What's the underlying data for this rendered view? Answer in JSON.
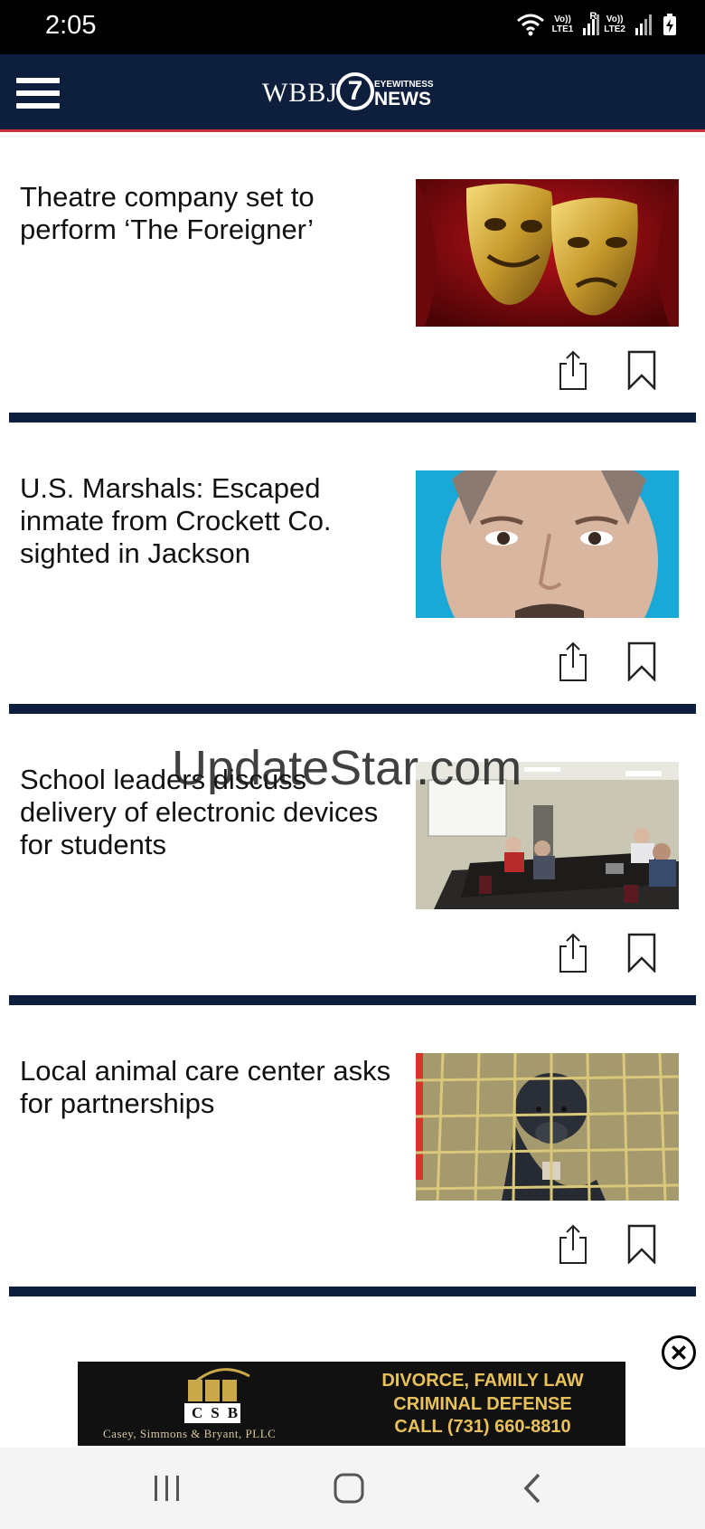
{
  "status_bar": {
    "time": "2:05",
    "sim1_top": "Vo))",
    "sim1_bottom": "LTE1",
    "roaming": "R",
    "sim2_top": "Vo))",
    "sim2_bottom": "LTE2",
    "icons": [
      "wifi-icon",
      "signal-icon",
      "signal-icon",
      "battery-charging-icon"
    ]
  },
  "header": {
    "logo_text": "WBBJ",
    "logo_number": "7",
    "logo_sub_top": "EYEWITNESS",
    "logo_sub_bottom": "NEWS",
    "colors": {
      "header_bg": "#0e1f3e",
      "accent_line": "#c8333a"
    }
  },
  "articles": [
    {
      "title": "Theatre company set to perform ‘The Foreigner’",
      "thumb": "theatre masks image"
    },
    {
      "title": "U.S. Marshals: Escaped inmate from Crockett Co. sighted in Jackson",
      "thumb": "mugshot image"
    },
    {
      "title": "School leaders discuss delivery of electronic devices for students",
      "thumb": "meeting room image"
    },
    {
      "title": "Local animal care center asks for partnerships",
      "thumb": "dog in kennel image"
    }
  ],
  "watermark": "UpdateStar.com",
  "ad": {
    "logo_letters": "CSB",
    "firm_name": "Casey, Simmons & Bryant, PLLC",
    "line1": "DIVORCE, FAMILY LAW",
    "line2": "CRIMINAL DEFENSE",
    "line3": "CALL (731) 660-8810"
  }
}
